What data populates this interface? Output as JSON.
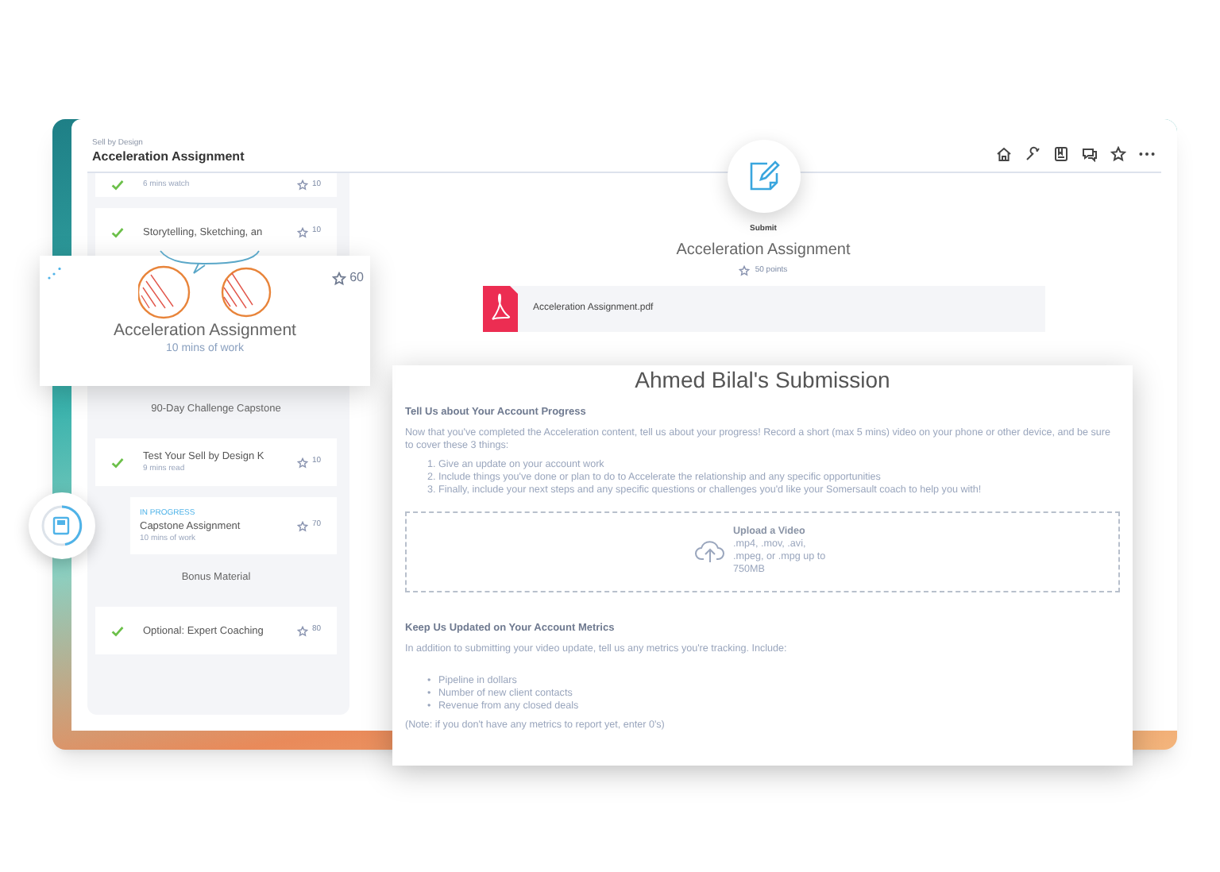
{
  "header": {
    "breadcrumb": "Sell by Design",
    "title": "Acceleration Assignment"
  },
  "sidebar": {
    "items": [
      {
        "kind": "lesson",
        "completed": true,
        "meta": "6 mins watch",
        "points": "10"
      },
      {
        "kind": "lesson",
        "completed": true,
        "title": "Storytelling, Sketching, an",
        "points": "10"
      },
      {
        "kind": "featured",
        "title": "Acceleration Assignment",
        "meta": "10 mins of work",
        "points": "60"
      },
      {
        "kind": "heading",
        "title": "90-Day Challenge Capstone"
      },
      {
        "kind": "lesson",
        "completed": true,
        "title": "Test Your Sell by Design K",
        "meta": "9 mins read",
        "points": "10"
      },
      {
        "kind": "lesson",
        "status": "IN PROGRESS",
        "title": "Capstone Assignment",
        "meta": "10 mins of work",
        "points": "70"
      },
      {
        "kind": "heading",
        "title": "Bonus Material"
      },
      {
        "kind": "lesson",
        "completed": true,
        "title": "Optional: Expert Coaching",
        "points": "80"
      }
    ]
  },
  "assignment": {
    "action_label": "Submit",
    "title": "Acceleration Assignment",
    "points": "50 points",
    "attachment": "Acceleration Assignment.pdf"
  },
  "submission": {
    "title": "Ahmed Bilal's Submission",
    "blocks": [
      {
        "kind": "heading",
        "text": "Tell Us about Your Account Progress"
      },
      {
        "kind": "paragraph",
        "text": "Now that you've completed the Acceleration content, tell us about your progress! Record a short (max 5 mins) video on your phone or other device, and be sure to cover these 3 things:"
      },
      {
        "kind": "ordered",
        "items": [
          {
            "marker": "1.",
            "text": "Give an update on your account work"
          },
          {
            "marker": "2.",
            "text": "Include things you've done or plan to do to Accelerate the relationship and any specific opportunities"
          },
          {
            "marker": "3.",
            "text": "Finally, include your next steps and any specific questions or challenges you'd like your Somersault coach to help you with!"
          }
        ]
      },
      {
        "kind": "upload",
        "title": "Upload a Video",
        "hint": ".mp4, .mov, .avi, .mpeg, or .mpg up to 750MB"
      },
      {
        "kind": "heading",
        "text": "Keep Us Updated on Your Account Metrics"
      },
      {
        "kind": "paragraph",
        "text": "In addition to submitting your video update, tell us any metrics you're tracking. Include:"
      },
      {
        "kind": "bullets",
        "items": [
          {
            "marker": "•",
            "text": "Pipeline in dollars"
          },
          {
            "marker": "•",
            "text": "Number of new client contacts"
          },
          {
            "marker": "•",
            "text": "Revenue from any closed deals"
          }
        ]
      },
      {
        "kind": "paragraph",
        "text": "(Note: if you don't have any metrics to report yet, enter 0's)"
      }
    ]
  }
}
